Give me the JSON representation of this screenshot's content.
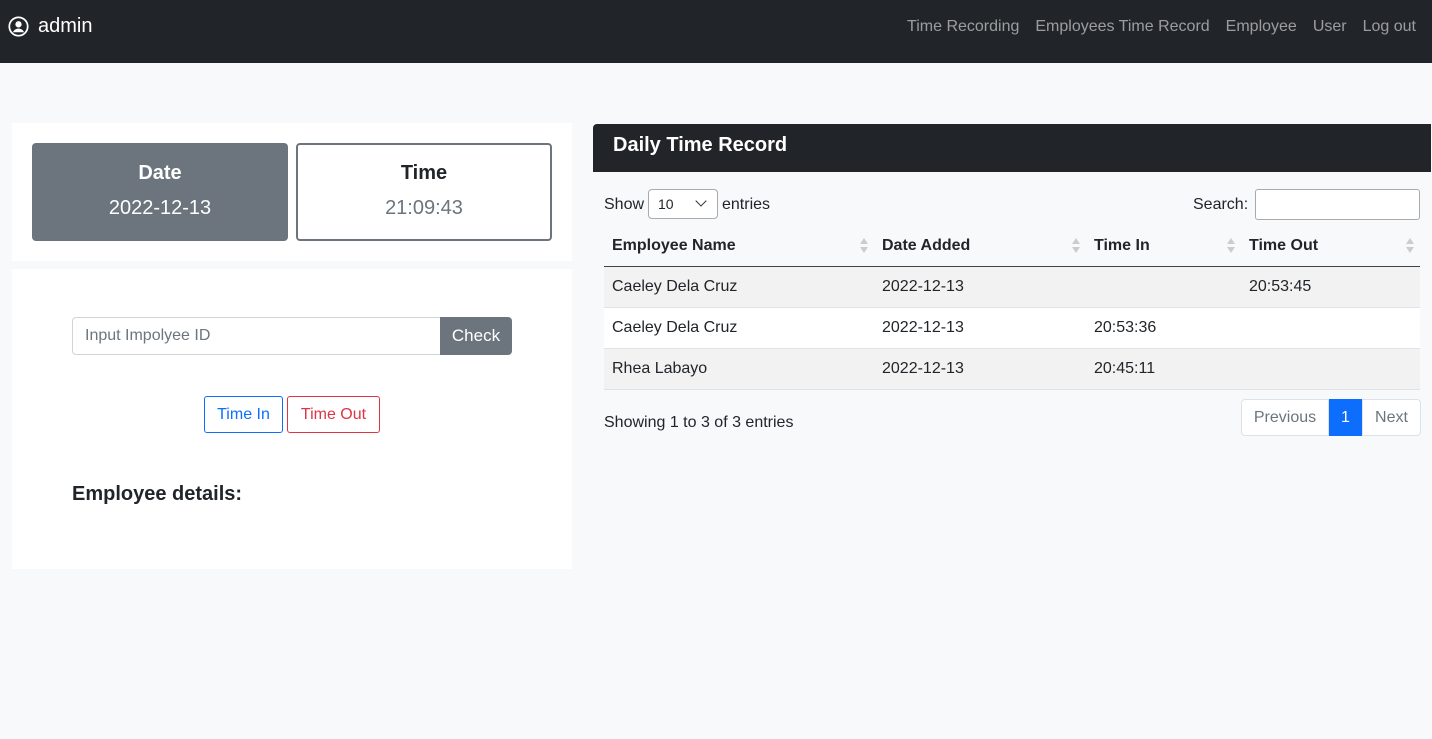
{
  "navbar": {
    "brand": "admin",
    "brand_icon": "user-circle-icon",
    "links": [
      "Time Recording",
      "Employees Time Record",
      "Employee",
      "User",
      "Log out"
    ]
  },
  "clock": {
    "date_label": "Date",
    "date_value": "2022-12-13",
    "time_label": "Time",
    "time_value": "21:09:43"
  },
  "form": {
    "id_placeholder": "Input Impolyee ID",
    "check_label": "Check",
    "time_in_label": "Time In",
    "time_out_label": "Time Out",
    "details_heading": "Employee details:"
  },
  "dtr": {
    "title": "Daily Time Record",
    "show_label": "Show",
    "entries_value": "10",
    "entries_label": "entries",
    "search_label": "Search:",
    "columns": [
      "Employee Name",
      "Date Added",
      "Time In",
      "Time Out"
    ],
    "rows": [
      [
        "Caeley Dela Cruz",
        "2022-12-13",
        "",
        "20:53:45"
      ],
      [
        "Caeley Dela Cruz",
        "2022-12-13",
        "20:53:36",
        ""
      ],
      [
        "Rhea Labayo",
        "2022-12-13",
        "20:45:11",
        ""
      ]
    ],
    "info": "Showing 1 to 3 of 3 entries",
    "pager": {
      "previous": "Previous",
      "page": "1",
      "next": "Next"
    }
  },
  "colors": {
    "navbar_bg": "#212529",
    "primary": "#0d6efd",
    "danger": "#dc3545",
    "secondary": "#6c757d"
  }
}
